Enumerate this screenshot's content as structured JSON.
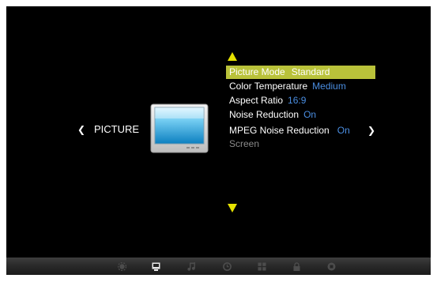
{
  "menu": {
    "category_label": "PICTURE",
    "nav_left_glyph": "❮",
    "nav_right_glyph": "❯",
    "items": [
      {
        "label": "Picture Mode",
        "value": "Standard",
        "selected": true
      },
      {
        "label": "Color Temperature",
        "value": "Medium"
      },
      {
        "label": "Aspect Ratio",
        "value": "16:9"
      },
      {
        "label": "Noise Reduction",
        "value": "On"
      },
      {
        "label": "MPEG Noise Reduction",
        "value": "On"
      },
      {
        "label": "Screen",
        "value": "",
        "disabled": true
      }
    ]
  },
  "bottom_bar": {
    "icons": [
      {
        "name": "channel-icon",
        "active": false
      },
      {
        "name": "picture-icon",
        "active": true
      },
      {
        "name": "sound-icon",
        "active": false
      },
      {
        "name": "time-icon",
        "active": false
      },
      {
        "name": "setup-icon",
        "active": false
      },
      {
        "name": "lock-icon",
        "active": false
      },
      {
        "name": "usb-icon",
        "active": false
      }
    ]
  },
  "colors": {
    "background": "#000000",
    "highlight": "#b9c23a",
    "arrow": "#e6e200",
    "value_text": "#4a8de0",
    "disabled_text": "#8a8a8a"
  }
}
